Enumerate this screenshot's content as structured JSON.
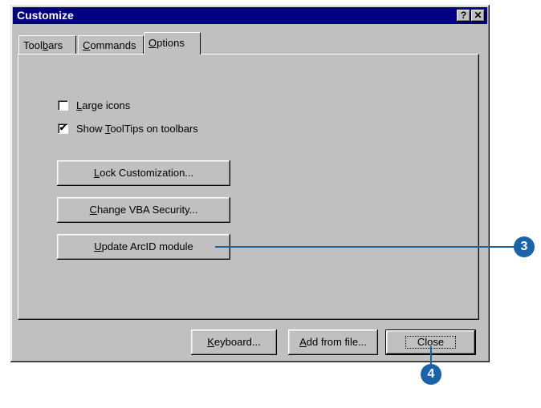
{
  "window": {
    "title": "Customize",
    "help_glyph": "?",
    "close_glyph": "✕"
  },
  "tabs": [
    {
      "pre": "Tool",
      "u": "b",
      "post": "ars",
      "active": false
    },
    {
      "pre": "",
      "u": "C",
      "post": "ommands",
      "active": false
    },
    {
      "pre": "",
      "u": "O",
      "post": "ptions",
      "active": true
    }
  ],
  "options": {
    "large_icons": {
      "pre": "",
      "u": "L",
      "post": "arge icons",
      "checked": false
    },
    "show_tooltips": {
      "pre": "Show ",
      "u": "T",
      "post": "oolTips on toolbars",
      "checked": true,
      "check_glyph": "✔"
    }
  },
  "panel_buttons": [
    {
      "pre": "",
      "u": "L",
      "post": "ock Customization..."
    },
    {
      "pre": "",
      "u": "C",
      "post": "hange VBA Security..."
    },
    {
      "pre": "",
      "u": "U",
      "post": "pdate ArcID module"
    }
  ],
  "footer_buttons": {
    "keyboard": {
      "pre": "",
      "u": "K",
      "post": "eyboard..."
    },
    "add_from_file": {
      "pre": "",
      "u": "A",
      "post": "dd from file..."
    },
    "close": {
      "label": "Close"
    }
  },
  "callouts": {
    "step3": "3",
    "step4": "4",
    "color": "#1b63a9"
  }
}
